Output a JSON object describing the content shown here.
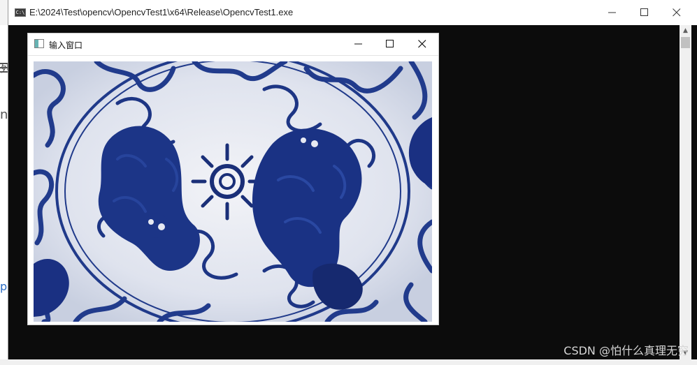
{
  "console_window": {
    "title": "E:\\2024\\Test\\opencv\\OpencvTest1\\x64\\Release\\OpencvTest1.exe",
    "icon": "console-app-icon",
    "icon_text": "C:\\",
    "buttons": [
      "minimize-icon",
      "maximize-icon",
      "close-icon"
    ]
  },
  "image_window": {
    "title": "输入窗口",
    "icon": "image-window-icon",
    "buttons": [
      "minimize-icon",
      "maximize-icon",
      "close-icon"
    ],
    "image": "blue-and-white-porcelain-plate-with-lions"
  },
  "background_page": {
    "fragment_1": "列",
    "fragment_2": "nc",
    "fragment_3": "pe"
  },
  "watermark": "CSDN @怕什么真理无穷",
  "colors": {
    "console_bg": "#0c0c0c",
    "titlebar_bg": "#ffffff",
    "porcelain_blue": "#1f3b8f",
    "porcelain_white": "#e9ecf4"
  }
}
